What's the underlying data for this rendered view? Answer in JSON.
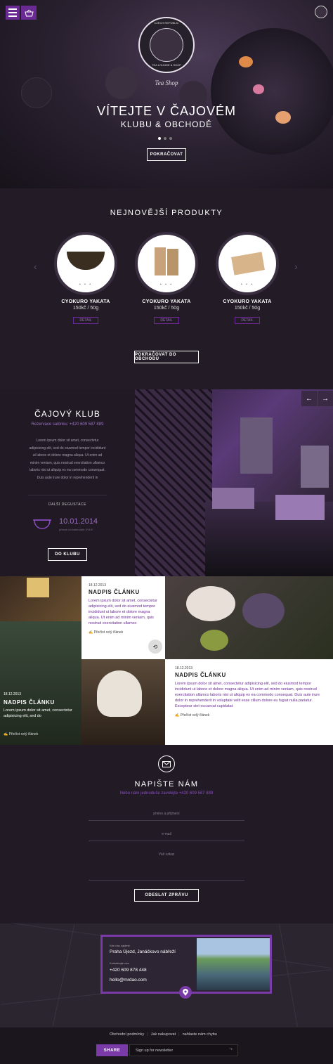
{
  "hero": {
    "logo_top": "CZECH REPUBLIC",
    "logo_bottom": "TEA LOUNGE & SHOP",
    "brand_script": "Tea Shop",
    "title_line1": "VÍTEJTE V ČAJOVÉM",
    "title_line2": "KLUBU & OBCHODĚ",
    "cta": "POKRAČOVAT"
  },
  "products": {
    "title": "NEJNOVĚJŠÍ PRODUKTY",
    "items": [
      {
        "name": "CYOKURO YAKATA",
        "price": "150kč / 50g",
        "button": "DETAIL",
        "pager": "• • •"
      },
      {
        "name": "CYOKURO YAKATA",
        "price": "150kč / 50g",
        "button": "DETAIL",
        "pager": "• • •"
      },
      {
        "name": "CYOKURO YAKATA",
        "price": "150kč / 50g",
        "button": "DETAIL",
        "pager": "• • •"
      }
    ],
    "prev_arrow": "‹",
    "next_arrow": "›",
    "cta": "POKRAČOVAT DO OBCHODU"
  },
  "club": {
    "title": "ČAJOVÝ KLUB",
    "reservation": "Rezervace salónku: +420 609 587 889",
    "body": "Lorem ipsum dolor sit amet, consectetur adipisicing elit, sed do eiusmod tempor incididunt ut labore et dolore magna aliqua. Ut enim ad minim veniam, quis nostrud exercitation ullamco laboris nisi ut aliquip ex ea commodo consequat. Duis aute irure dolor in reprehenderit in",
    "next_label": "DALŠÍ DEGUSTACE",
    "next_date": "10.01.2014",
    "next_sub": "přesné do kalendáře KVUV",
    "cta": "DO KLUBU",
    "prev": "←",
    "next": "→"
  },
  "blog": {
    "card1": {
      "date": "18.12.2013",
      "title": "NADPIS ČLÁNKU",
      "body": "Lorem ipsum dolor sit amet, consectetur adipisicing elit, sed do eiusmod tempor incididunt ut labore et dolore magna aliqua. Ut enim ad minim veniam, quis nostrud exercitation ullamco",
      "more": "Přečíst celý článek"
    },
    "card2": {
      "date": "18.12.2013",
      "title": "NADPIS ČLÁNKU",
      "body": "Lorem ipsum dolor sit amet, consectetur adipisicing elit, sed do eiusmod tempor incididunt ut labore et dolore magna aliqua. Ut enim ad minim veniam, quis nostrud exercitation ullamco laboris nisi ut aliquip ex ea commodo consequat. Duis aute irure dolor in reprehenderit in voluptate velit esse cillum dolore eu fugiat nulla pariatur. Excepteur sint occaecat cupidatat",
      "more": "Přečíst celý článek"
    },
    "card3": {
      "date": "18.12.2013",
      "title": "NADPIS ČLÁNKU",
      "body": "Lorem ipsum dolor sit amet, consectetur adipisicing elit, sed do",
      "more": "Přečíst celý článek"
    }
  },
  "contact": {
    "title": "NAPIŠTE NÁM",
    "subtitle": "Nebo nám jednoduše zavolejte +420 609 587 889",
    "name_placeholder": "jméno a příjmení",
    "email_placeholder": "e-mail",
    "message_placeholder": "Váš vzkaz",
    "submit": "ODESLAT ZPRÁVU"
  },
  "map": {
    "address_label": "Kde nás najdete",
    "address": "Praha Újezd, Janáčkovo nábřeží",
    "phone_label": "Kontaktujte nás",
    "phone": "+420 609 878 448",
    "email": "hello@mrdao.com"
  },
  "footer": {
    "links": [
      "Obchodní podmínky",
      "Jak nakupovat",
      "nahlaste nám chybu"
    ],
    "share": "SHARE",
    "newsletter_placeholder": "Sign up for newsletter",
    "newsletter_arrow": "→"
  },
  "colors": {
    "accent": "#6a2a94",
    "bg": "#1d1720"
  }
}
